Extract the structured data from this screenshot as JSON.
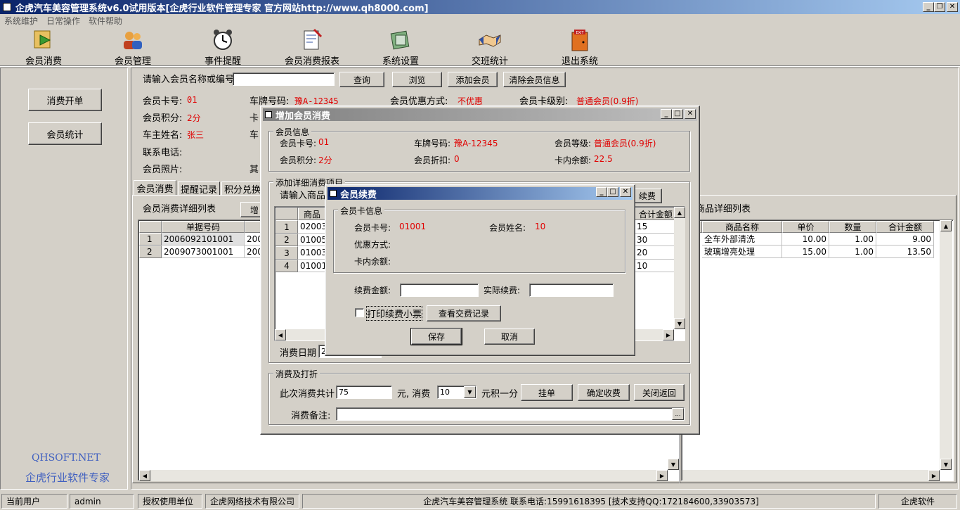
{
  "window": {
    "title": "企虎汽车美容管理系统v6.0试用版本[企虎行业软件管理专家 官方网站http://www.qh8000.com]",
    "controls": [
      "_",
      "❐",
      "✕"
    ]
  },
  "menu": [
    "系统维护",
    "日常操作",
    "软件帮助"
  ],
  "toolbar": [
    {
      "label": "会员消费",
      "icon": "member-consume-icon"
    },
    {
      "label": "会员管理",
      "icon": "member-manage-icon"
    },
    {
      "label": "事件提醒",
      "icon": "alarm-clock-icon"
    },
    {
      "label": "会员消费报表",
      "icon": "report-icon"
    },
    {
      "label": "系统设置",
      "icon": "settings-icon"
    },
    {
      "label": "交班统计",
      "icon": "handshake-icon"
    },
    {
      "label": "退出系统",
      "icon": "exit-icon"
    }
  ],
  "sidebar": {
    "btn_open": "消费开单",
    "btn_stats": "会员统计",
    "brand_en": "QHSOFT.NET",
    "brand_cn": "企虎行业软件专家"
  },
  "search": {
    "label": "请输入会员名称或编号",
    "value": "",
    "buttons": [
      "查询",
      "浏览",
      "添加会员",
      "清除会员信息"
    ]
  },
  "member": {
    "card_label": "会员卡号:",
    "card": "01",
    "plate_label": "车牌号码:",
    "plate": "豫A-12345",
    "discount_label": "会员优惠方式:",
    "discount": "不优惠",
    "level_label": "会员卡级别:",
    "level": "普通会员(0.9折)",
    "points_label": "会员积分:",
    "points": "2分",
    "card2_label": "卡",
    "owner_label": "车主姓名:",
    "owner": "张三",
    "car_label": "车",
    "phone_label": "联系电话:",
    "photo_label": "会员照片:",
    "other_label": "其"
  },
  "tabs": [
    "会员消费",
    "提醒记录",
    "积分兑换"
  ],
  "consume_list": {
    "title": "会员消费详细列表",
    "add_btn": "增",
    "header": "单据号码",
    "rows": [
      {
        "no": "1",
        "id": "2006092101001",
        "d": "200"
      },
      {
        "no": "2",
        "id": "2009073001001",
        "d": "200"
      }
    ]
  },
  "product_list": {
    "title": "商品详细列表",
    "headers": [
      "商品名称",
      "单价",
      "数量",
      "合计金额"
    ],
    "rows": [
      [
        "全车外部清洗",
        "10.00",
        "1.00",
        "9.00"
      ],
      [
        "玻璃增亮处理",
        "15.00",
        "1.00",
        "13.50"
      ]
    ]
  },
  "dlg_add": {
    "title": "增加会员消费",
    "member_group": "会员信息",
    "card_label": "会员卡号:",
    "card": "01",
    "plate_label": "车牌号码:",
    "plate": "豫A-12345",
    "grade_label": "会员等级:",
    "grade": "普通会员(0.9折)",
    "points_label": "会员积分:",
    "points": "2分",
    "discount_label": "会员折扣:",
    "discount": "0",
    "balance_label": "卡内余额:",
    "balance": "22.5",
    "detail_group": "添加详细消费项目",
    "prompt": "请输入商品",
    "renew_btn": "续费",
    "header_prod": "商品",
    "header_total": "合计金额",
    "rows": [
      {
        "no": "1",
        "code": "02003",
        "total": "15"
      },
      {
        "no": "2",
        "code": "01005",
        "total": "30"
      },
      {
        "no": "3",
        "code": "01003",
        "total": "20"
      },
      {
        "no": "4",
        "code": "01001",
        "total": "10"
      }
    ],
    "date_label": "消费日期",
    "date_value": "2",
    "pay_group": "消费及打折",
    "total_label": "此次消费共计",
    "total_value": "75",
    "unit_label": "元, 消费",
    "rate_value": "10",
    "per_point": "元积一分",
    "btn_hold": "挂单",
    "btn_confirm": "确定收费",
    "btn_close": "关闭返回",
    "note_label": "消费备注:"
  },
  "dlg_renew": {
    "title": "会员续费",
    "group": "会员卡信息",
    "card_label": "会员卡号:",
    "card": "01001",
    "name_label": "会员姓名:",
    "name": "10",
    "discount_label": "优惠方式:",
    "balance_label": "卡内余额:",
    "amount_label": "续费金额:",
    "actual_label": "实际续费:",
    "print_label": "打印续费小票",
    "btn_history": "查看交费记录",
    "btn_save": "保存",
    "btn_cancel": "取消"
  },
  "status": {
    "user_label": "当前用户",
    "user": "admin",
    "auth_label": "授权使用单位",
    "company": "企虎网络技术有限公司",
    "info": "企虎汽车美容管理系统 联系电话:15991618395 [技术支持QQ:172184600,33903573]",
    "brand": "企虎软件"
  }
}
